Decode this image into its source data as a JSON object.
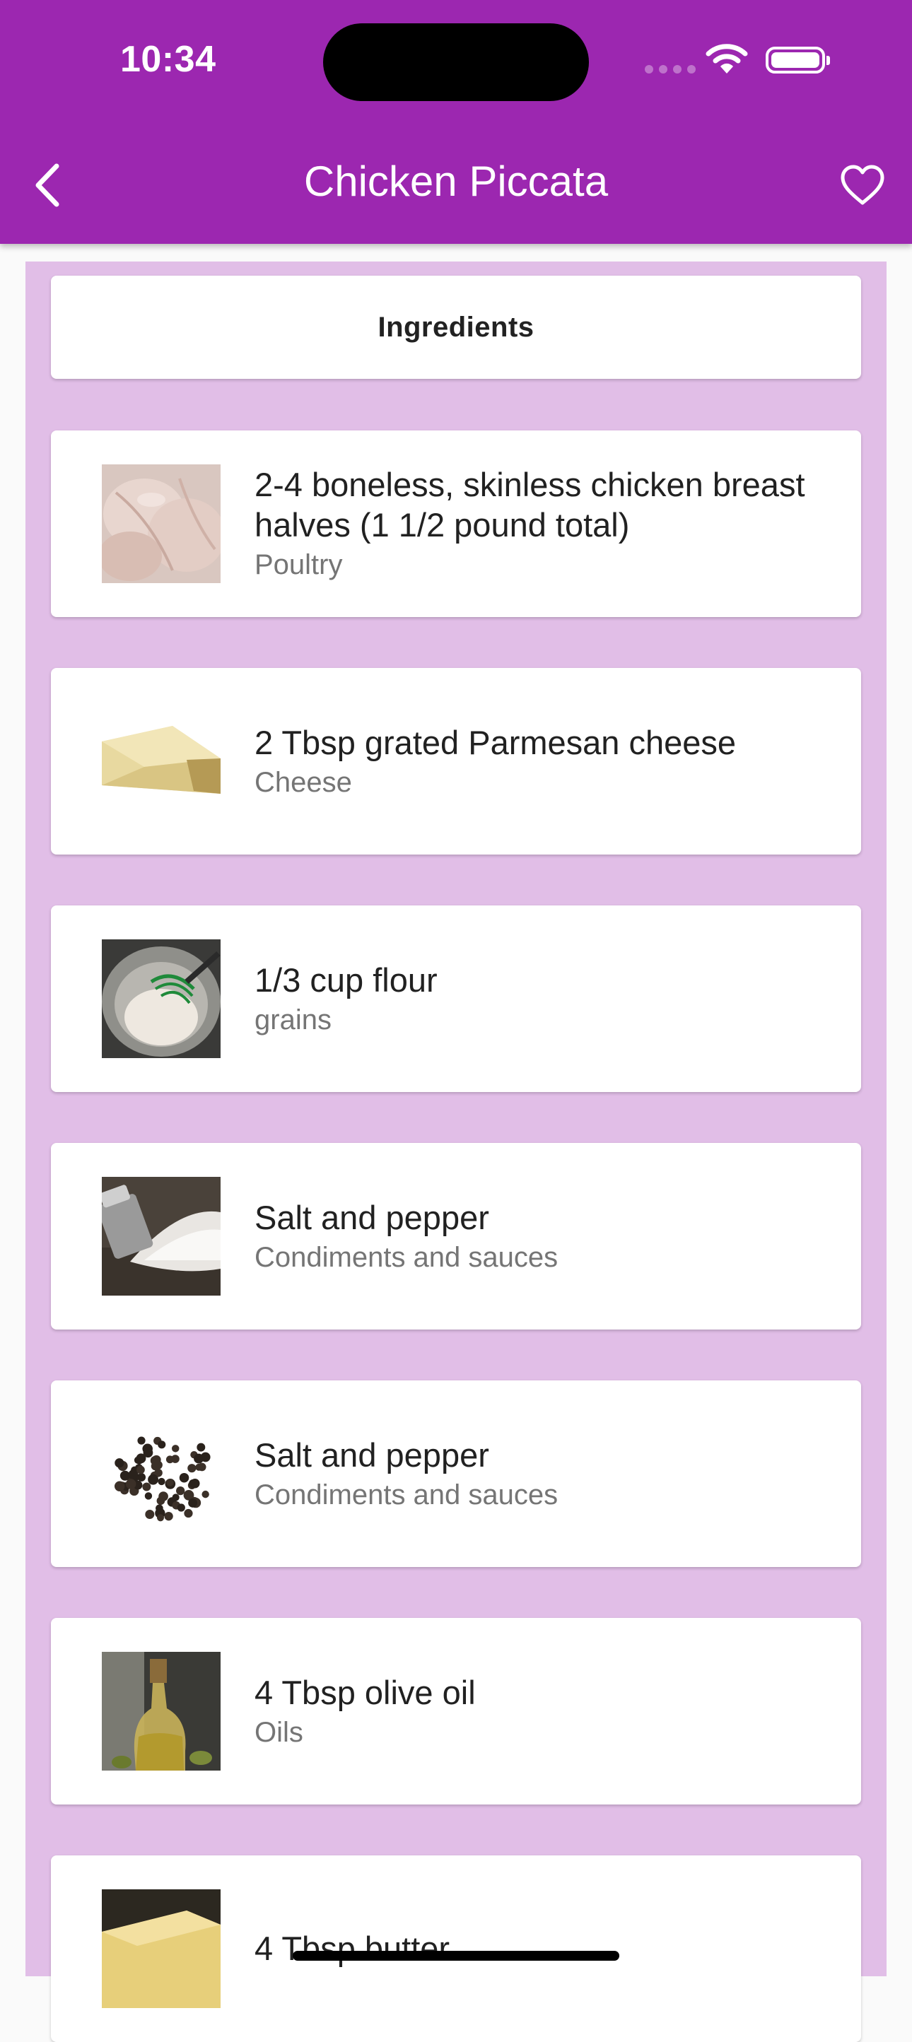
{
  "status_bar": {
    "time": "10:34"
  },
  "app_bar": {
    "title": "Chicken Piccata"
  },
  "section": {
    "header": "Ingredients"
  },
  "colors": {
    "primary": "#9c27b0",
    "panel": "#e1bee7"
  },
  "ingredients": [
    {
      "name": "2-4 boneless, skinless chicken breast halves (1 1/2 pound total)",
      "category": "Poultry",
      "image": "chicken-breast-photo"
    },
    {
      "name": "2 Tbsp grated Parmesan cheese",
      "category": "Cheese",
      "image": "parmesan-cheese-photo"
    },
    {
      "name": "1/3 cup flour",
      "category": "grains",
      "image": "flour-bowl-photo"
    },
    {
      "name": "Salt and pepper",
      "category": "Condiments and sauces",
      "image": "salt-shaker-photo"
    },
    {
      "name": "Salt and pepper",
      "category": "Condiments and sauces",
      "image": "peppercorns-photo"
    },
    {
      "name": "4 Tbsp olive oil",
      "category": "Oils",
      "image": "olive-oil-bottle-photo"
    },
    {
      "name": "4 Tbsp butter",
      "category": "",
      "image": "butter-photo"
    }
  ]
}
